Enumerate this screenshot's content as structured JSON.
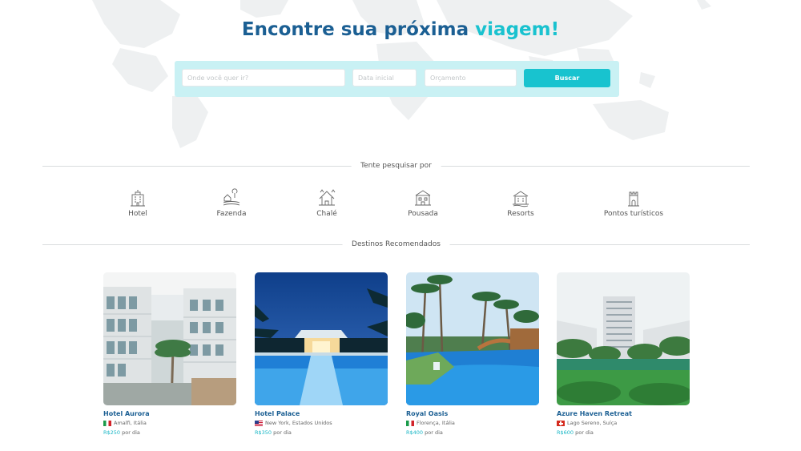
{
  "hero": {
    "title_main": "Encontre sua próxima",
    "title_accent": "viagem!"
  },
  "search": {
    "where_placeholder": "Onde você quer ir?",
    "date_placeholder": "Data inicial",
    "budget_placeholder": "Orçamento",
    "button_label": "Buscar"
  },
  "try_search": {
    "heading": "Tente pesquisar por",
    "categories": [
      {
        "label": "Hotel",
        "icon": "hotel-icon"
      },
      {
        "label": "Fazenda",
        "icon": "farm-icon"
      },
      {
        "label": "Chalé",
        "icon": "chalet-icon"
      },
      {
        "label": "Pousada",
        "icon": "inn-icon"
      },
      {
        "label": "Resorts",
        "icon": "resort-icon"
      },
      {
        "label": "Pontos turísticos",
        "icon": "landmark-icon"
      }
    ]
  },
  "recommended": {
    "heading": "Destinos Recomendados",
    "items": [
      {
        "name": "Hotel Aurora",
        "location": "Amalfi, Itália",
        "flag": "italy-flag-icon",
        "price": "R$250",
        "per": "por dia"
      },
      {
        "name": "Hotel Palace",
        "location": "New York, Estados Unidos",
        "flag": "usa-flag-icon",
        "price": "R$350",
        "per": "por dia"
      },
      {
        "name": "Royal Oasis",
        "location": "Florença, Itália",
        "flag": "italy-flag-icon",
        "price": "R$400",
        "per": "por dia"
      },
      {
        "name": "Azure Haven Retreat",
        "location": "Lago Sereno, Suíça",
        "flag": "switzerland-flag-icon",
        "price": "R$600",
        "per": "por dia"
      }
    ]
  },
  "colors": {
    "primary": "#1b5f93",
    "accent": "#19c2cf",
    "search_bg": "#c9f1f4"
  }
}
